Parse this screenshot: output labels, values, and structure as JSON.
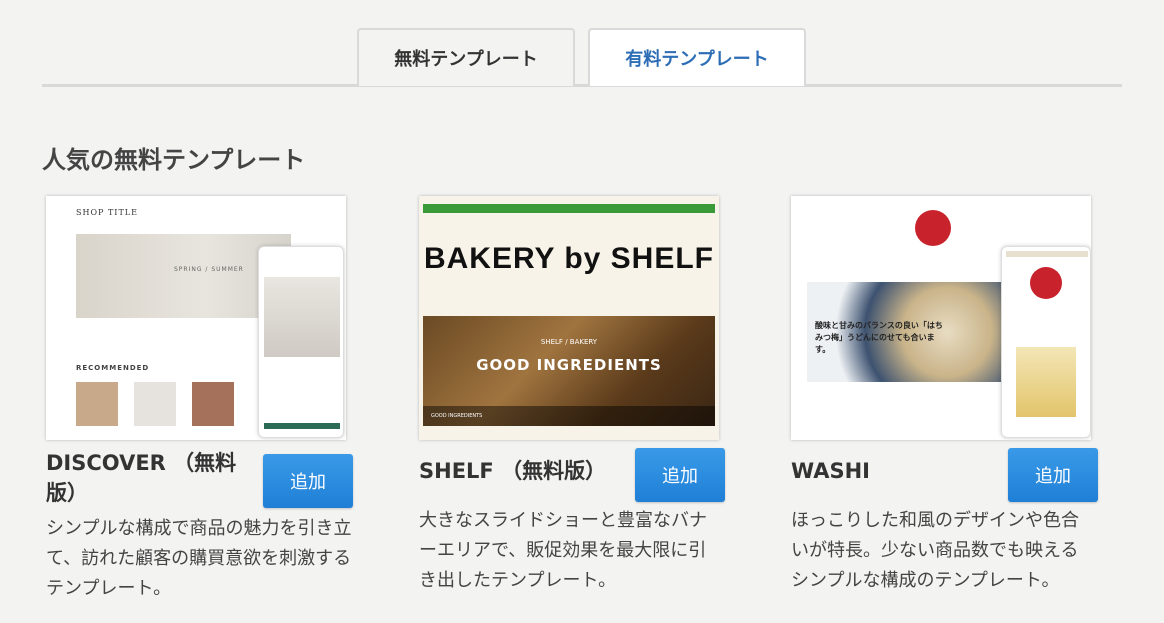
{
  "tabs": {
    "free_label": "無料テンプレート",
    "paid_label": "有料テンプレート"
  },
  "section_title": "人気の無料テンプレート",
  "templates": [
    {
      "name": "DISCOVER （無料版）",
      "add_label": "追加",
      "description": "シンプルな構成で商品の魅力を引き立て、訪れた顧客の購買意欲を刺激するテンプレート。",
      "preview": {
        "shop_title": "SHOP TITLE",
        "hero_text": "SPRING / SUMMER",
        "recommended": "RECOMMENDED"
      }
    },
    {
      "name": "SHELF （無料版）",
      "add_label": "追加",
      "description": "大きなスライドショーと豊富なバナーエリアで、販促効果を最大限に引き出したテンプレート。",
      "preview": {
        "logo": "BAKERY by SHELF",
        "slide_sub": "SHELF / BAKERY",
        "slide_title": "GOOD INGREDIENTS",
        "caption": "GOOD INGREDIENTS"
      }
    },
    {
      "name": "WASHI",
      "add_label": "追加",
      "description": "ほっこりした和風のデザインや色合いが特長。少ない商品数でも映えるシンプルな構成のテンプレート。",
      "preview": {
        "banner_text": "酸味と甘みのバランスの良い「はちみつ梅」うどんにのせても合います。"
      }
    }
  ],
  "colors": {
    "accent_blue": "#2d6db5",
    "button_blue": "#2a8ae0",
    "shelf_green": "#3a9a3a",
    "washi_red": "#c8232c"
  }
}
